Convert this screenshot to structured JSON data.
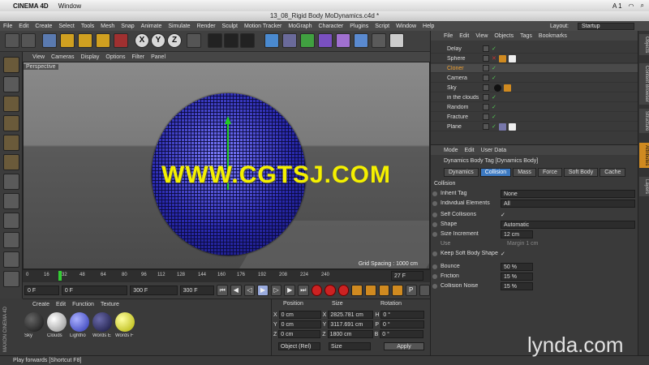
{
  "mac_menu": {
    "app": "CINEMA 4D",
    "window": "Window",
    "status_right": "A 1"
  },
  "title": "13_08_Rigid Body MoDynamics.c4d *",
  "menu": [
    "File",
    "Edit",
    "Create",
    "Select",
    "Tools",
    "Mesh",
    "Snap",
    "Animate",
    "Simulate",
    "Render",
    "Sculpt",
    "Motion Tracker",
    "MoGraph",
    "Character",
    "Plugins",
    "Script",
    "Window",
    "Help"
  ],
  "layout": {
    "label": "Layout:",
    "value": "Startup"
  },
  "toolbar": {
    "axis_x": "X",
    "axis_y": "Y",
    "axis_z": "Z"
  },
  "viewport": {
    "menu": [
      "View",
      "Cameras",
      "Display",
      "Options",
      "Filter",
      "Panel"
    ],
    "camera_label": "Perspective",
    "grid_spacing": "Grid Spacing : 1000 cm",
    "watermark": "WWW.CGTSJ.COM"
  },
  "timeline": {
    "ticks": [
      "0",
      "16",
      "32",
      "48",
      "64",
      "80",
      "96",
      "112",
      "128",
      "144",
      "160",
      "176",
      "192",
      "208",
      "224",
      "240"
    ],
    "current": "27 F"
  },
  "transport": {
    "start": "0 F",
    "min": "0 F",
    "max": "300 F",
    "end": "300 F"
  },
  "materials": {
    "menu": [
      "Create",
      "Edit",
      "Function",
      "Texture"
    ],
    "items": [
      {
        "label": "Sky",
        "color": "#222222"
      },
      {
        "label": "Clouds",
        "color": "#dddddd"
      },
      {
        "label": "Lightho",
        "color": "#4a5ad8"
      },
      {
        "label": "Words E",
        "color": "#26265a"
      },
      {
        "label": "Words F",
        "color": "#e0e000"
      }
    ]
  },
  "coords": {
    "headers": [
      "Position",
      "Size",
      "Rotation"
    ],
    "rows": [
      {
        "axis": "X",
        "pos": "0 cm",
        "size_axis": "X",
        "size": "2825.781 cm",
        "rot_axis": "H",
        "rot": "0 °"
      },
      {
        "axis": "Y",
        "pos": "0 cm",
        "size_axis": "Y",
        "size": "3117.691 cm",
        "rot_axis": "P",
        "rot": "0 °"
      },
      {
        "axis": "Z",
        "pos": "0 cm",
        "size_axis": "Z",
        "size": "1800 cm",
        "rot_axis": "B",
        "rot": "0 °"
      }
    ],
    "mode": "Object (Rel)",
    "size_mode": "Size",
    "apply": "Apply"
  },
  "status": "Play forwards [Shortcut F8]",
  "objects": {
    "menu": [
      "File",
      "Edit",
      "View",
      "Objects",
      "Tags",
      "Bookmarks"
    ],
    "items": [
      {
        "name": "Delay",
        "color": "#dddddd"
      },
      {
        "name": "Sphere",
        "color": "#dddddd"
      },
      {
        "name": "Cloner",
        "color": "#f0a030"
      },
      {
        "name": "Camera",
        "color": "#dddddd"
      },
      {
        "name": "Sky",
        "color": "#dddddd"
      },
      {
        "name": "in the clouds",
        "color": "#dddddd"
      },
      {
        "name": "Random",
        "color": "#dddddd"
      },
      {
        "name": "Fracture",
        "color": "#dddddd"
      },
      {
        "name": "Plane",
        "color": "#dddddd"
      }
    ]
  },
  "attributes": {
    "menu": [
      "Mode",
      "Edit",
      "User Data"
    ],
    "tag_title": "Dynamics Body Tag [Dynamics Body]",
    "tabs": [
      "Dynamics",
      "Collision",
      "Mass",
      "Force",
      "Soft Body",
      "Cache"
    ],
    "active_tab": "Collision",
    "section": "Collision",
    "fields": [
      {
        "label": "Inherit Tag",
        "value": "None"
      },
      {
        "label": "Individual Elements",
        "value": "All"
      },
      {
        "label": "Self Collisions",
        "value": "✓"
      },
      {
        "label": "Shape",
        "value": "Automatic"
      },
      {
        "label": "Size Increment",
        "value": "12 cm"
      },
      {
        "label": "Use",
        "value": "Margin  1 cm"
      },
      {
        "label": "Keep Soft Body Shape",
        "value": "✓"
      },
      {
        "label": "Bounce",
        "value": "50 %"
      },
      {
        "label": "Friction",
        "value": "15 %"
      },
      {
        "label": "Collision Noise",
        "value": "15 %"
      }
    ]
  },
  "side_tabs": [
    "Objects",
    "Content Browser",
    "Structure",
    "Attributes",
    "Layers"
  ],
  "brand": "lynda.com"
}
